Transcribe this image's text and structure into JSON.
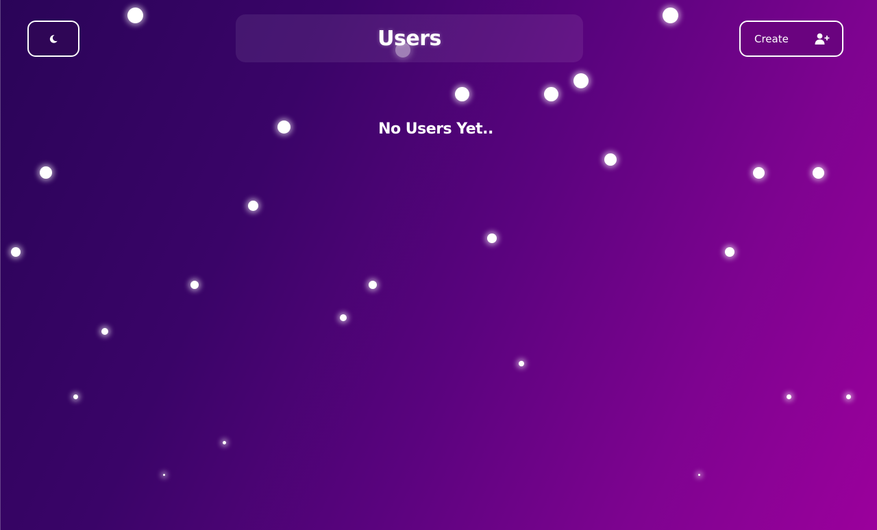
{
  "header": {
    "title": "Users",
    "create_label": "Create",
    "theme_toggle_icon": "moon-icon",
    "create_icon": "user-plus-icon"
  },
  "main": {
    "empty_message": "No Users Yet.."
  },
  "colors": {
    "background_start": "#2a0458",
    "background_end": "#9b009c",
    "text": "#ffffff"
  }
}
